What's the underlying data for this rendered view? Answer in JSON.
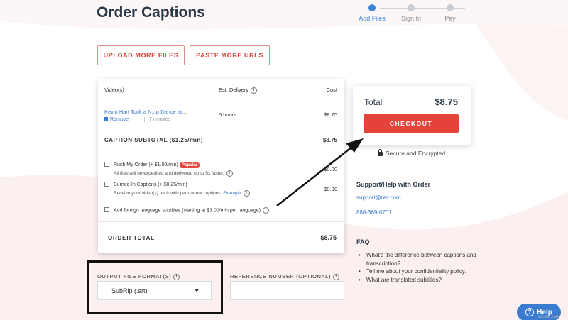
{
  "page": {
    "title": "Order Captions"
  },
  "stepper": {
    "steps": [
      {
        "label": "Add Files",
        "active": true
      },
      {
        "label": "Sign In",
        "active": false
      },
      {
        "label": "Pay",
        "active": false
      }
    ]
  },
  "buttons": {
    "upload": "UPLOAD MORE FILES",
    "paste": "PASTE MORE URLS"
  },
  "order": {
    "headers": {
      "videos": "Video(s)",
      "delivery": "Est. Delivery",
      "cost": "Cost"
    },
    "item": {
      "title": "Kevin Hart Took a N...p Dance at...",
      "remove": "Remove",
      "duration": "7 minutes",
      "delivery": "5 hours",
      "cost": "$8.75"
    },
    "subtotal_label": "CAPTION SUBTOTAL ($1.25/min)",
    "subtotal_value": "$8.75",
    "options": [
      {
        "label": "Rush My Order (+ $1.00/min)",
        "badge": "Popular",
        "sub": "All files will be expedited and delivered up to 5x faster.",
        "price": "$0.00"
      },
      {
        "label": "Burned-In Captions (+ $0.25/min)",
        "sub": "Receive your video(s) back with permanent captions.",
        "sub_link": "Example",
        "price": "$0.00"
      },
      {
        "label": "Add foreign language subtitles (starting at $3.00/min per language)"
      }
    ],
    "total_label": "ORDER TOTAL",
    "total_value": "$8.75"
  },
  "checkout": {
    "total_label": "Total",
    "total_value": "$8.75",
    "button": "CHECKOUT",
    "secure": "Secure and Encrypted"
  },
  "support": {
    "title": "Support/Help with Order",
    "email": "support@rev.com",
    "phone": "888-369-0701"
  },
  "faq": {
    "title": "FAQ",
    "items": [
      "What's the difference between captions and transcription?",
      "Tell me about your confidentiality policy.",
      "What are translated subtitles?"
    ]
  },
  "fields": {
    "output_label": "OUTPUT FILE FORMAT(S)",
    "output_value": "SubRip (.srt)",
    "reference_label": "REFERENCE NUMBER (OPTIONAL)",
    "reference_value": ""
  },
  "help": {
    "label": "Help"
  },
  "watermark": "wsxdn.com",
  "colors": {
    "accent": "#e5433a",
    "link": "#3b7bd0",
    "active_step": "#3b86d8"
  }
}
